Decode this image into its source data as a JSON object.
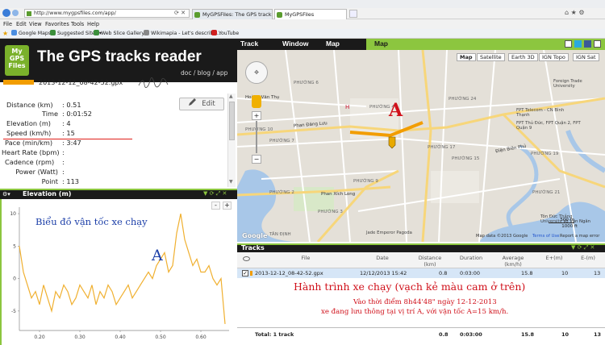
{
  "browser": {
    "url": "http://www.mygpsfiles.com/app/",
    "tabs": [
      "MyGPSFiles: The GPS tracks re...",
      "MyGPSFiles"
    ],
    "menu": [
      "File",
      "Edit",
      "View",
      "Favorites",
      "Tools",
      "Help"
    ],
    "favorites": [
      "Google Maps",
      "Suggested Sites ▾",
      "Web Slice Gallery ▾",
      "Wikimapia - Let's describe...",
      "YouTube"
    ]
  },
  "header": {
    "logo": [
      "My",
      "GPS",
      "Files"
    ],
    "title": "The GPS tracks reader",
    "links": "doc / blog / app"
  },
  "app_nav": [
    "Track",
    "Window",
    "Map"
  ],
  "map_panel_title": "Map",
  "file": {
    "name": "2013-12-12_08-42-52.gpx",
    "signature": "Sgk345",
    "edit_label": "Edit"
  },
  "stats": [
    {
      "label": "Distance (km)",
      "value": ": 0.51"
    },
    {
      "label": "Time",
      "value": ": 0:01:52"
    },
    {
      "label": "Elevation (m)",
      "value": ": 4"
    },
    {
      "label": "Speed (km/h)",
      "value": ": 15"
    },
    {
      "label": "Pace (min/km)",
      "value": ": 3:47"
    },
    {
      "label": "Heart Rate (bpm)",
      "value": ":"
    },
    {
      "label": "Cadence (rpm)",
      "value": ":"
    },
    {
      "label": "Power (Watt)",
      "value": ":"
    },
    {
      "label": "Point",
      "value": ": 113"
    }
  ],
  "elevation": {
    "title": "Elevation (m)",
    "annotation": "Biểu đồ vận tốc xe chạy",
    "marker": "A",
    "y_ticks": [
      "10",
      "5",
      "0",
      "-5"
    ],
    "x_ticks": [
      "0.20",
      "0.30",
      "0.40",
      "0.50",
      "0.60"
    ],
    "zoom_minus": "-",
    "zoom_plus": "+"
  },
  "chart_data": {
    "type": "line",
    "title": "Elevation (m)",
    "xlabel": "",
    "ylabel": "",
    "xlim": [
      0.15,
      0.67
    ],
    "ylim": [
      -8,
      11
    ],
    "x": [
      0.15,
      0.16,
      0.17,
      0.18,
      0.19,
      0.2,
      0.21,
      0.22,
      0.23,
      0.24,
      0.25,
      0.26,
      0.27,
      0.28,
      0.29,
      0.3,
      0.31,
      0.32,
      0.33,
      0.34,
      0.35,
      0.36,
      0.37,
      0.38,
      0.39,
      0.4,
      0.41,
      0.42,
      0.43,
      0.44,
      0.45,
      0.46,
      0.47,
      0.48,
      0.49,
      0.5,
      0.51,
      0.52,
      0.53,
      0.54,
      0.55,
      0.56,
      0.57,
      0.58,
      0.59,
      0.6,
      0.61,
      0.62,
      0.63,
      0.64,
      0.65,
      0.66
    ],
    "series": [
      {
        "values": [
          5,
          1,
          -1,
          -3,
          -2,
          -4,
          -1,
          -3,
          -5,
          -2,
          -3,
          -1,
          -2,
          -4,
          -3,
          -1,
          -2,
          -3,
          -1,
          -4,
          -2,
          -3,
          -1,
          -2,
          -4,
          -3,
          -2,
          -1,
          -3,
          -2,
          -1,
          0,
          1,
          0,
          2,
          3,
          4,
          1,
          2,
          7,
          10,
          6,
          4,
          2,
          3,
          1,
          1,
          2,
          0,
          -1,
          0,
          -7
        ]
      }
    ]
  },
  "map": {
    "types": [
      "Map",
      "Satellite",
      "Earth 3D",
      "IGN Topo",
      "IGN Sat"
    ],
    "marker": "A",
    "labels": [
      {
        "text": "PHƯỜNG 7",
        "cls": "d"
      },
      {
        "text": "PHƯỜNG 6",
        "cls": "d"
      },
      {
        "text": "PHƯỜNG 10",
        "cls": "d"
      },
      {
        "text": "PHƯỜNG 9",
        "cls": "d"
      },
      {
        "text": "PHƯỜNG 4",
        "cls": "d"
      },
      {
        "text": "PHƯỜNG 2",
        "cls": "d"
      },
      {
        "text": "PHƯỜNG 3",
        "cls": "d"
      },
      {
        "text": "PHƯỜNG 24",
        "cls": "d"
      },
      {
        "text": "PHƯỜNG 17",
        "cls": "d"
      },
      {
        "text": "PHƯỜNG 15",
        "cls": "d"
      },
      {
        "text": "PHƯỜNG 21",
        "cls": "d"
      },
      {
        "text": "PHƯỜNG 19",
        "cls": "d"
      },
      {
        "text": "Phan Đăng Lưu",
        "cls": "r"
      },
      {
        "text": "Phan Xích Long",
        "cls": "r"
      },
      {
        "text": "Hoàng Văn Thụ",
        "cls": "r"
      },
      {
        "text": "Điện Biên Phủ",
        "cls": "r"
      },
      {
        "text": "Foreign Trade University",
        "cls": "p"
      },
      {
        "text": "FPT Telecom - CN Bình Thạnh",
        "cls": "p"
      },
      {
        "text": "FPT Thủ Đức, FPT Quận 2, FPT Quận 9",
        "cls": "p"
      },
      {
        "text": "Tôn Đức Thắng University",
        "cls": "p"
      },
      {
        "text": "Jade Emperor Pagoda",
        "cls": "p"
      },
      {
        "text": "TÂN ĐỊNH",
        "cls": "d"
      },
      {
        "text": "Võ Văn Ngân",
        "cls": "r"
      }
    ],
    "scale": [
      "500 m",
      "1000 ft"
    ],
    "attribution": "Map data ©2013 Google",
    "terms": "Terms of Use",
    "report": "Report a map error"
  },
  "tracks": {
    "title": "Tracks",
    "columns": [
      "File",
      "Date",
      "Distance (km)",
      "Duration",
      "Average (km/h)",
      "E+(m)",
      "E-(m)"
    ],
    "row": {
      "file": "2013-12-12_08-42-52.gpx",
      "date": "12/12/2013 15:42",
      "distance": "0.8",
      "duration": "0:03:00",
      "avg": "15.8",
      "eplus": "10",
      "eminus": "13"
    },
    "total": {
      "label": "Total: 1 track",
      "distance": "0.8",
      "duration": "0:03:00",
      "avg": "15.8",
      "eplus": "10",
      "eminus": "13"
    },
    "annotation_title": "Hành trình xe chạy (vạch kẻ màu cam ở trên)",
    "annotation_line1": "Vào thời điểm 8h44'48\" ngày 12-12-2013",
    "annotation_line2": "xe đang lưu thông tại vị trí A, với vận tốc A=15 km/h."
  },
  "colors": {
    "accent": "#8cc63f",
    "track": "#f29d00",
    "annotation": "#d0101a",
    "chart_annotation": "#1c3fa8"
  }
}
